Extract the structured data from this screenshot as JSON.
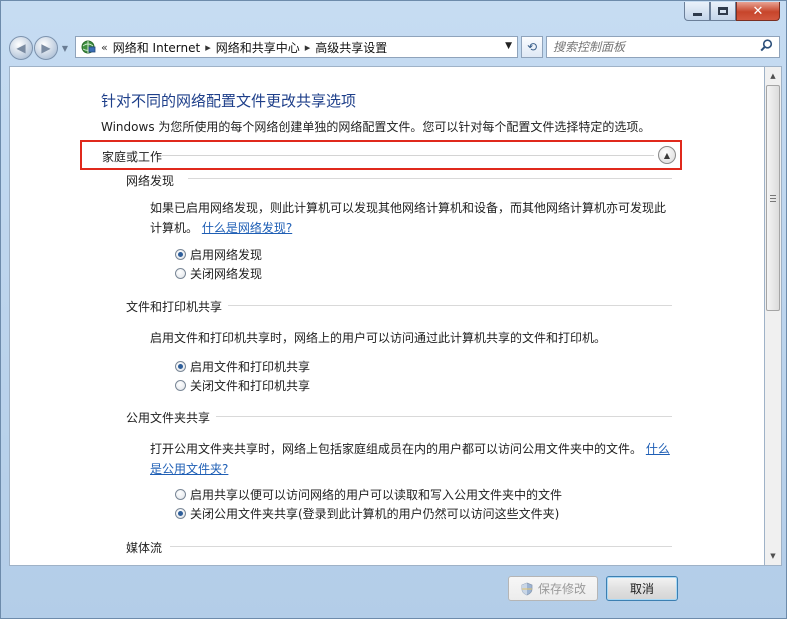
{
  "window": {
    "minimize_label": "",
    "colors": {
      "frame": "#c6dcf2",
      "close": "#c7452b",
      "title_text": "#1e3f8a",
      "link": "#1f5fb5",
      "highlight_box": "#e0291c"
    }
  },
  "nav": {
    "back_icon": "back-arrow-icon",
    "forward_icon": "forward-arrow-icon",
    "overflow": "«",
    "breadcrumb": [
      "网络和 Internet",
      "网络和共享中心",
      "高级共享设置"
    ],
    "search_placeholder": "搜索控制面板"
  },
  "page": {
    "title": "针对不同的网络配置文件更改共享选项",
    "description": "Windows 为您所使用的每个网络创建单独的网络配置文件。您可以针对每个配置文件选择特定的选项。",
    "profile": {
      "label": "家庭或工作",
      "sections": [
        {
          "heading": "网络发现",
          "text_line1": "如果已启用网络发现，则此计算机可以发现其他网络计算机和设备，而其他网络计算机亦可发现此",
          "text_line2": "计算机。",
          "link": "什么是网络发现?",
          "options": [
            {
              "label": "启用网络发现",
              "checked": true
            },
            {
              "label": "关闭网络发现",
              "checked": false
            }
          ]
        },
        {
          "heading": "文件和打印机共享",
          "text_line1": "启用文件和打印机共享时，网络上的用户可以访问通过此计算机共享的文件和打印机。",
          "options": [
            {
              "label": "启用文件和打印机共享",
              "checked": true
            },
            {
              "label": "关闭文件和打印机共享",
              "checked": false
            }
          ]
        },
        {
          "heading": "公用文件夹共享",
          "text_line1": "打开公用文件夹共享时，网络上包括家庭组成员在内的用户都可以访问公用文件夹中的文件。",
          "link_part1": "什么",
          "link_part2": "是公用文件夹?",
          "options": [
            {
              "label": "启用共享以便可以访问网络的用户可以读取和写入公用文件夹中的文件",
              "checked": false
            },
            {
              "label": "关闭公用文件夹共享(登录到此计算机的用户仍然可以访问这些文件夹)",
              "checked": true
            }
          ]
        },
        {
          "heading": "媒体流"
        }
      ]
    }
  },
  "footer": {
    "save_label": "保存修改",
    "cancel_label": "取消"
  }
}
